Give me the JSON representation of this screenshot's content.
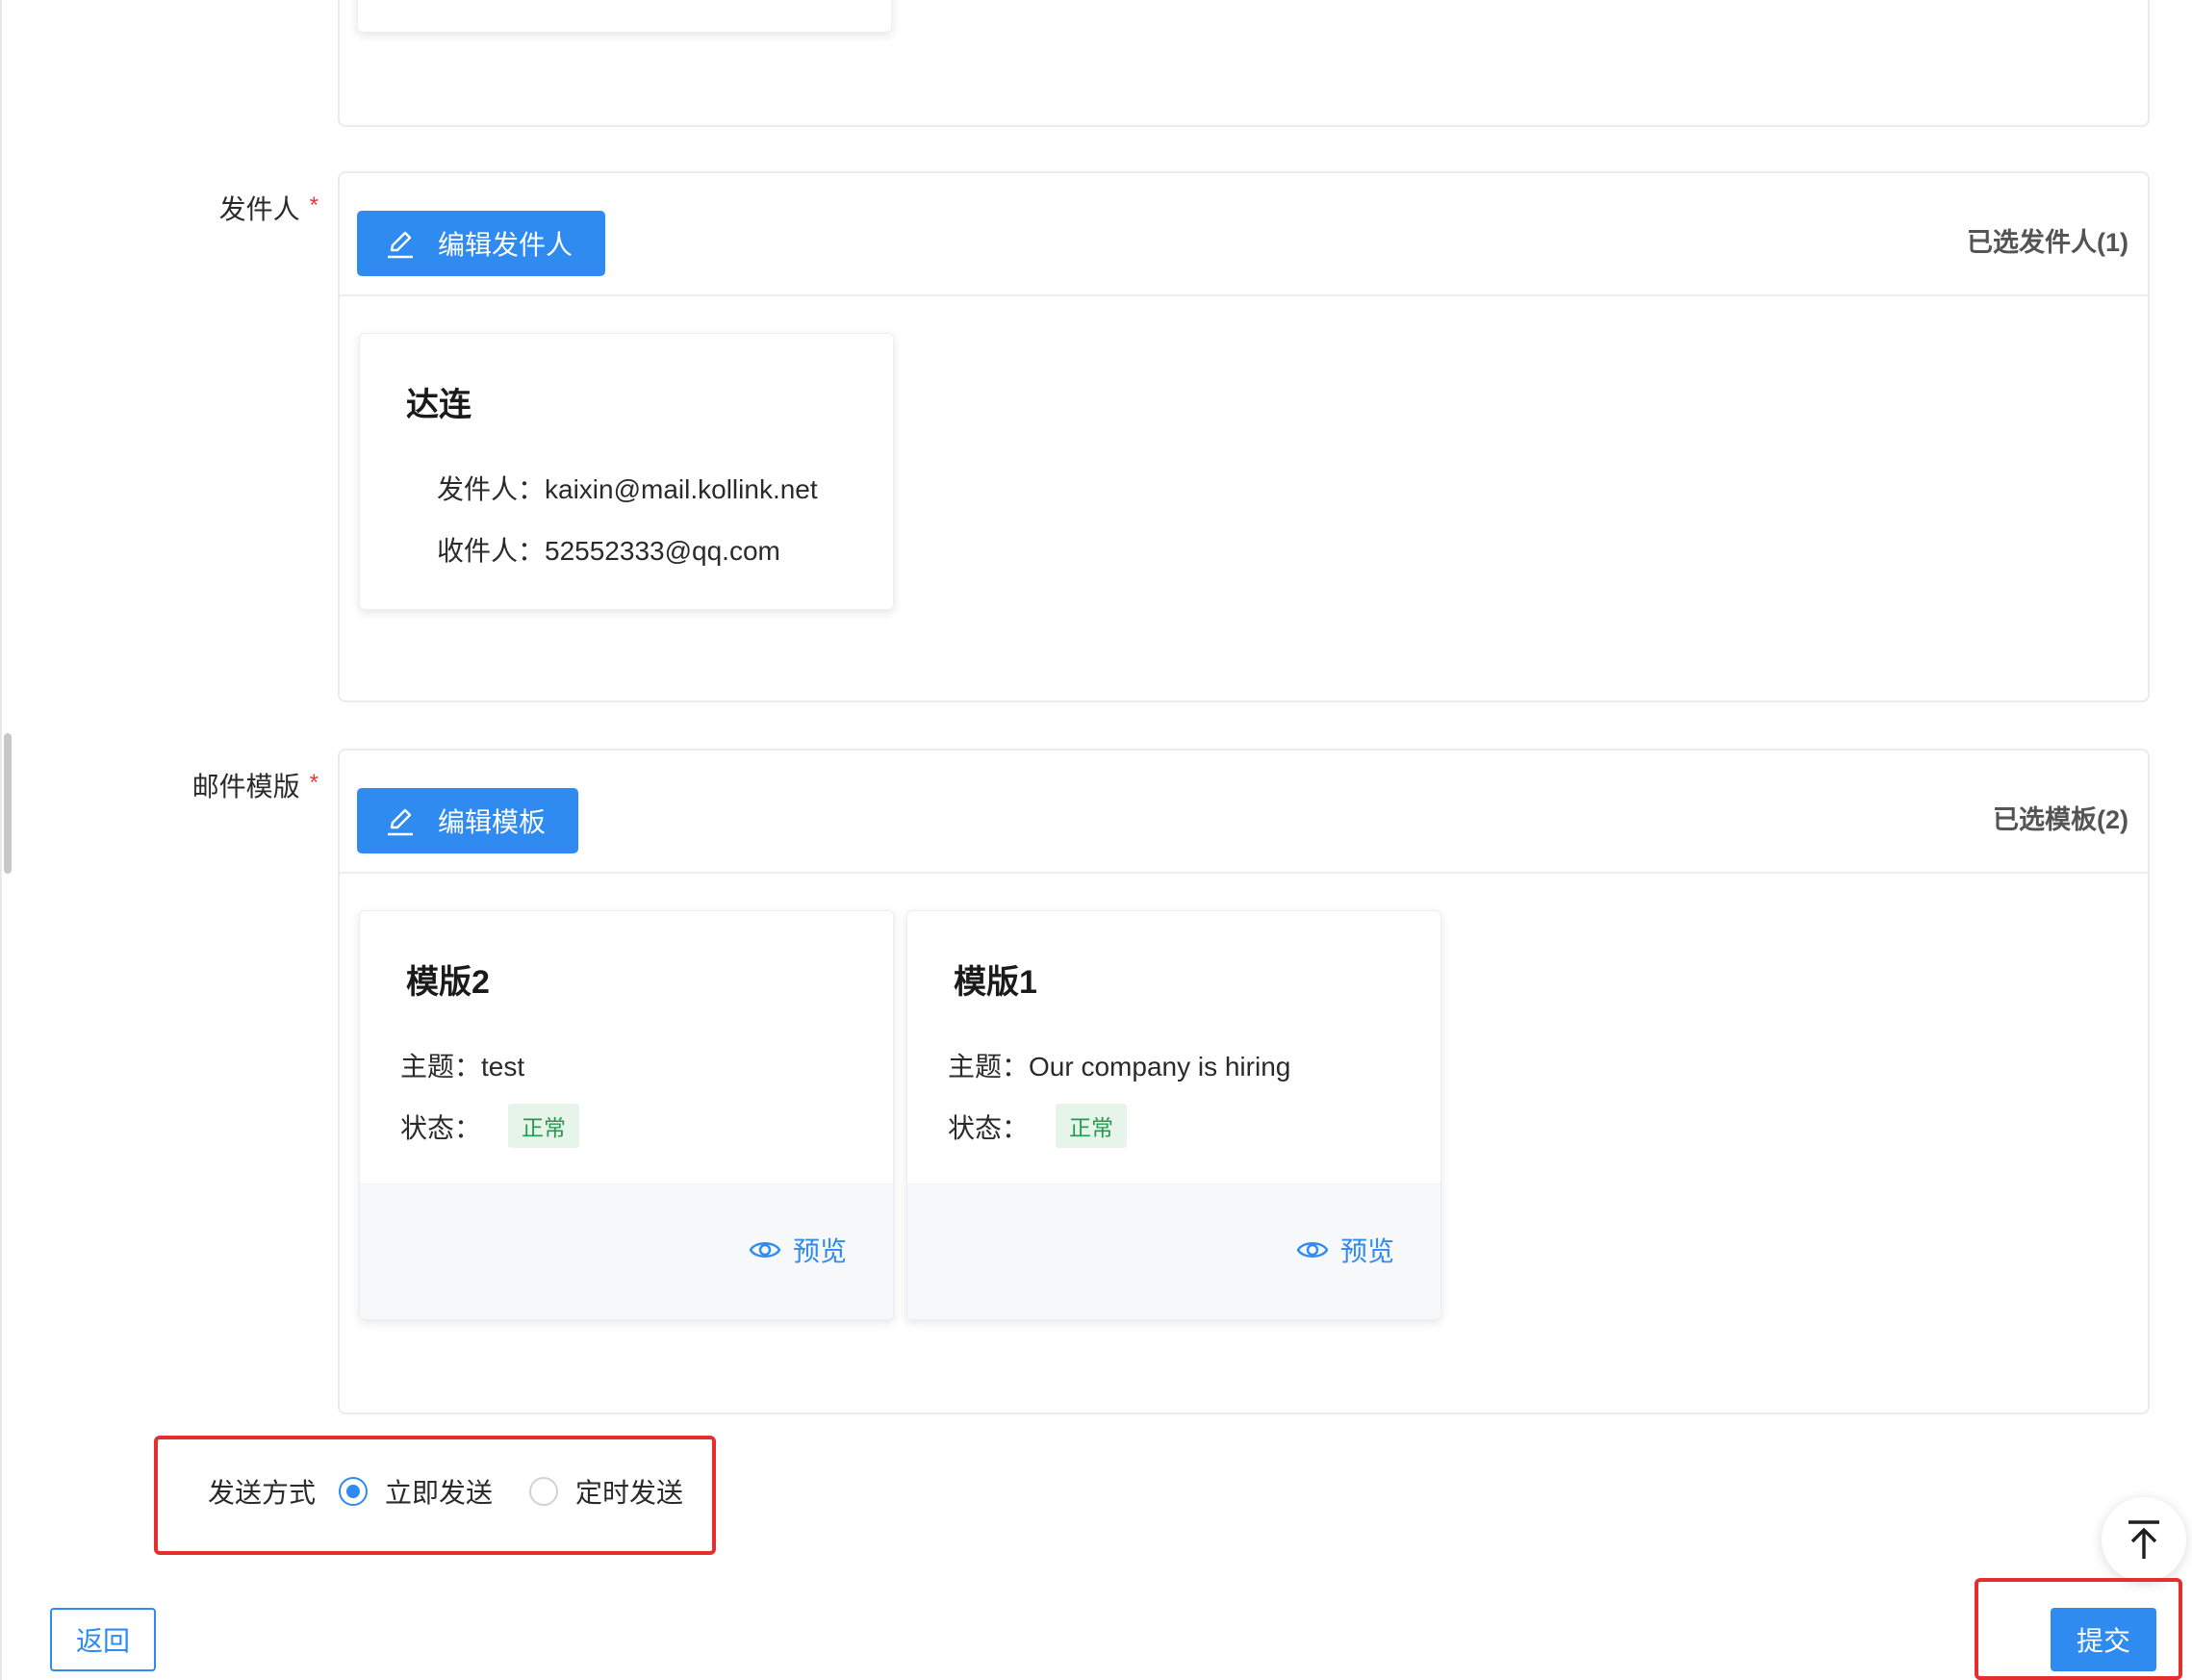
{
  "top_section": {},
  "sender": {
    "label": "发件人",
    "required_mark": "*",
    "edit_button": "编辑发件人",
    "count_label": "已选发件人(1)",
    "cards": [
      {
        "name": "达连",
        "from_label": "发件人：",
        "from": "kaixin@mail.kollink.net",
        "to_label": "收件人：",
        "to": "52552333@qq.com"
      }
    ]
  },
  "template": {
    "label": "邮件模版",
    "required_mark": "*",
    "edit_button": "编辑模板",
    "count_label": "已选模板(2)",
    "cards": [
      {
        "title": "模版2",
        "subject_label": "主题：",
        "subject": "test",
        "status_label": "状态：",
        "status": "正常",
        "preview": "预览"
      },
      {
        "title": "模版1",
        "subject_label": "主题：",
        "subject": "Our company is hiring",
        "status_label": "状态：",
        "status": "正常",
        "preview": "预览"
      }
    ]
  },
  "send_method": {
    "label": "发送方式",
    "options": [
      "立即发送",
      "定时发送"
    ],
    "selected": "立即发送"
  },
  "footer": {
    "back": "返回",
    "submit": "提交"
  },
  "icons": [
    "edit-icon",
    "eye-icon",
    "back-to-top-icon"
  ],
  "colors": {
    "primary": "#2f8bf0",
    "highlight": "#e52f2f",
    "status_green": "#25994f",
    "required": "#e23b3b"
  }
}
